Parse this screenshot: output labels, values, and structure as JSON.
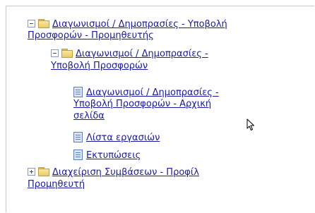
{
  "tree": {
    "node1": {
      "label_line1": "Διαγωνισμοί / Δημοπρασίες - Υποβολή",
      "label_line2": "Προσφορών - Προμηθευτής"
    },
    "node2": {
      "label_line1": "Διαγωνισμοί / Δημοπρασίες -",
      "label_line2": "Υποβολή Προσφορών"
    },
    "leaf1": {
      "label_line1": "Διαγωνισμοί / Δημοπρασίες -",
      "label_line2": "Υποβολή Προσφορών - Αρχική",
      "label_line3": "σελίδα"
    },
    "leaf2": {
      "label": "Λίστα εργασιών"
    },
    "leaf3": {
      "label": "Εκτυπώσεις"
    },
    "node3": {
      "label_line1": "Διαχείριση Συμβάσεων - Προφίλ",
      "label_line2": "Προμηθευτή"
    }
  },
  "icons": {
    "collapse": "minus-box-icon",
    "expand": "plus-box-icon",
    "folder": "folder-icon",
    "document": "document-icon",
    "cursor": "mouse-pointer-icon"
  },
  "colors": {
    "link": "#1a1aa8",
    "folder": "#eccb64",
    "document": "#5c7bc2"
  }
}
